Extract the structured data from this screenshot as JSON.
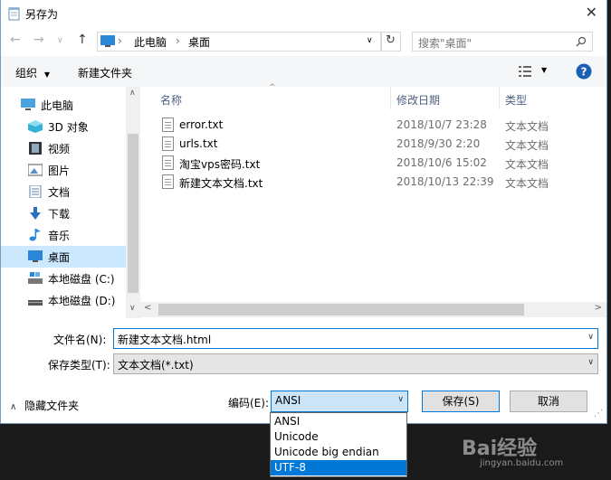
{
  "window": {
    "title": "另存为"
  },
  "address": {
    "crumbs": [
      "此电脑",
      "桌面"
    ],
    "search_placeholder": "搜索\"桌面\""
  },
  "toolbar": {
    "organize": "组织",
    "new_folder": "新建文件夹"
  },
  "nav": {
    "items": [
      {
        "label": "此电脑",
        "icon": "pc-icon"
      },
      {
        "label": "3D 对象",
        "icon": "cube-icon"
      },
      {
        "label": "视频",
        "icon": "video-icon"
      },
      {
        "label": "图片",
        "icon": "picture-icon"
      },
      {
        "label": "文档",
        "icon": "document-icon"
      },
      {
        "label": "下载",
        "icon": "download-icon"
      },
      {
        "label": "音乐",
        "icon": "music-icon"
      },
      {
        "label": "桌面",
        "icon": "desktop-icon",
        "selected": true
      },
      {
        "label": "本地磁盘 (C:)",
        "icon": "drive-icon"
      },
      {
        "label": "本地磁盘 (D:)",
        "icon": "drive-icon"
      }
    ]
  },
  "files": {
    "headers": {
      "name": "名称",
      "date": "修改日期",
      "type": "类型"
    },
    "rows": [
      {
        "name": "error.txt",
        "date": "2018/10/7 23:28",
        "type": "文本文档"
      },
      {
        "name": "urls.txt",
        "date": "2018/9/30 2:20",
        "type": "文本文档"
      },
      {
        "name": "淘宝vps密码.txt",
        "date": "2018/10/6 15:02",
        "type": "文本文档"
      },
      {
        "name": "新建文本文档.txt",
        "date": "2018/10/13 22:39",
        "type": "文本文档"
      }
    ]
  },
  "form": {
    "filename_label": "文件名(N):",
    "filename_value": "新建文本文档.html",
    "filetype_label": "保存类型(T):",
    "filetype_value": "文本文档(*.txt)",
    "hide_folders": "隐藏文件夹",
    "encoding_label": "编码(E):",
    "encoding_value": "ANSI",
    "encoding_options": [
      "ANSI",
      "Unicode",
      "Unicode big endian",
      "UTF-8"
    ],
    "encoding_highlight": "UTF-8",
    "save_button": "保存(S)",
    "cancel_button": "取消"
  },
  "watermark": {
    "logo": "Bai经验",
    "url": "jingyan.baidu.com"
  },
  "colors": {
    "accent": "#0078d7",
    "selection": "#cce8ff",
    "help": "#1a5fb4"
  }
}
